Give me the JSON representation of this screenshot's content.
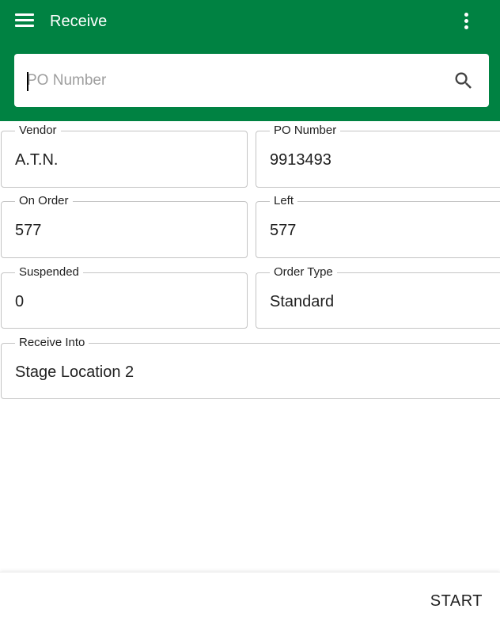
{
  "header": {
    "title": "Receive",
    "menu_icon": "menu-icon",
    "more_icon": "more-vert-icon",
    "background_color": "#008242"
  },
  "search": {
    "placeholder": "PO Number",
    "value": "",
    "icon": "search-icon"
  },
  "details": {
    "vendor": {
      "label": "Vendor",
      "value": "A.T.N."
    },
    "po_number": {
      "label": "PO Number",
      "value": "9913493"
    },
    "on_order": {
      "label": "On Order",
      "value": "577"
    },
    "left": {
      "label": "Left",
      "value": "577"
    },
    "suspended": {
      "label": "Suspended",
      "value": "0"
    },
    "order_type": {
      "label": "Order Type",
      "value": "Standard"
    },
    "receive_into": {
      "label": "Receive Into",
      "value": "Stage Location 2"
    }
  },
  "footer": {
    "start_label": "START"
  }
}
